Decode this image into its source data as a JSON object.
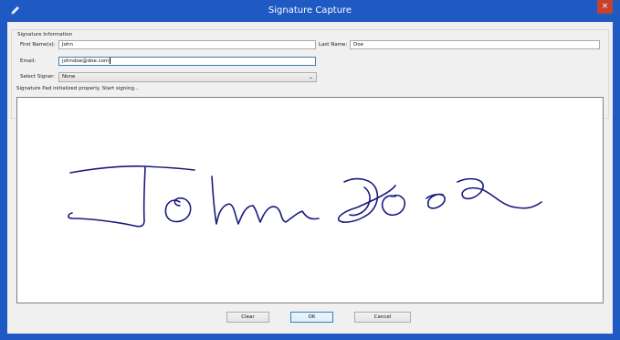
{
  "window": {
    "title": "Signature Capture",
    "close_glyph": "×",
    "app_icon": "pen-icon",
    "title_color": "#1f59c4",
    "close_color": "#c7422c"
  },
  "group": {
    "title": "Signature Information"
  },
  "form": {
    "first_name_label": "First Name(s):",
    "first_name_value": "John",
    "last_name_label": "Last Name:",
    "last_name_value": "Doe",
    "email_label": "Email:",
    "email_value": "johndoe@doe.com",
    "signer_label": "Select Signer:",
    "signer_value": "None",
    "signer_arrow": "⌄"
  },
  "status": {
    "message": "Signature Pad initialized properly. Start signing..."
  },
  "signature": {
    "ink_color": "#1a1a7e",
    "content": "John Doe"
  },
  "buttons": {
    "clear": "Clear",
    "ok": "OK",
    "cancel": "Cancel"
  }
}
